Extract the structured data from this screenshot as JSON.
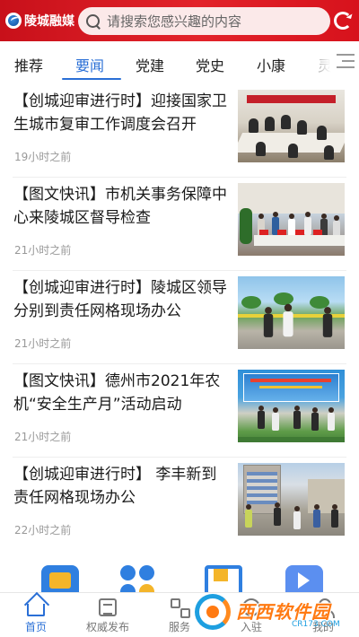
{
  "header": {
    "logo_text": "陵城融媒",
    "search_placeholder": "请搜索您感兴趣的内容"
  },
  "tabs": [
    {
      "label": "推荐",
      "active": false
    },
    {
      "label": "要闻",
      "active": true
    },
    {
      "label": "党建",
      "active": false
    },
    {
      "label": "党史",
      "active": false
    },
    {
      "label": "小康",
      "active": false
    },
    {
      "label": "灵",
      "active": false
    }
  ],
  "news": [
    {
      "title": "【创城迎审进行时】迎接国家卫生城市复审工作调度会召开",
      "time": "19小时之前",
      "thumb": "meeting-room-photo"
    },
    {
      "title": "【图文快讯】市机关事务保障中心来陵城区督导检查",
      "time": "21小时之前",
      "thumb": "inspection-meeting-photo"
    },
    {
      "title": "【创城迎审进行时】陵城区领导分别到责任网格现场办公",
      "time": "21小时之前",
      "thumb": "street-inspection-photo"
    },
    {
      "title": "【图文快讯】德州市2021年农机“安全生产月”活动启动",
      "time": "21小时之前",
      "thumb": "outdoor-event-photo"
    },
    {
      "title": "【创城迎审进行时】 李丰新到责任网格现场办公",
      "time": "22小时之前",
      "thumb": "street-site-photo"
    }
  ],
  "bottom_nav": [
    {
      "label": "首页",
      "icon": "home-icon",
      "active": true
    },
    {
      "label": "权威发布",
      "icon": "document-icon",
      "active": false
    },
    {
      "label": "服务",
      "icon": "grid-icon",
      "active": false
    },
    {
      "label": "入驻",
      "icon": "join-icon",
      "active": false
    },
    {
      "label": "我的",
      "icon": "user-icon",
      "active": false
    }
  ],
  "watermark": {
    "text": "西西软件园",
    "url": "CR173.COM"
  },
  "colors": {
    "header_red": "#d7121c",
    "accent_blue": "#2a6fd6",
    "time_gray": "#999999"
  }
}
